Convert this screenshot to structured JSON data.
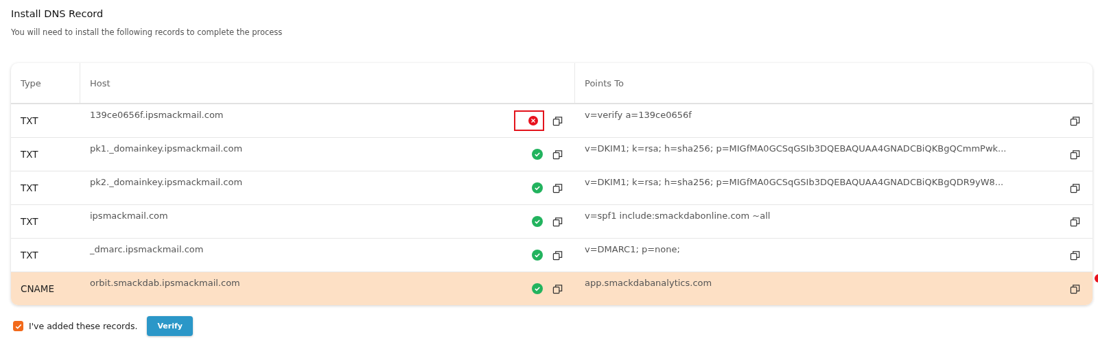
{
  "title": "Install DNS Record",
  "subtitle": "You will need to install the following records to complete the process",
  "table": {
    "columns": [
      "Type",
      "Host",
      "Points To"
    ],
    "rows": [
      {
        "type": "TXT",
        "host": "139ce0656f.ipsmackmail.com",
        "verified": false,
        "flagged": true,
        "points_to": "v=verify a=139ce0656f",
        "selected": false
      },
      {
        "type": "TXT",
        "host": "pk1._domainkey.ipsmackmail.com",
        "verified": true,
        "flagged": false,
        "points_to": "v=DKIM1; k=rsa; h=sha256; p=MIGfMA0GCSqGSIb3DQEBAQUAA4GNADCBiQKBgQCmmPwk...",
        "selected": false
      },
      {
        "type": "TXT",
        "host": "pk2._domainkey.ipsmackmail.com",
        "verified": true,
        "flagged": false,
        "points_to": "v=DKIM1; k=rsa; h=sha256; p=MIGfMA0GCSqGSIb3DQEBAQUAA4GNADCBiQKBgQDR9yW8...",
        "selected": false
      },
      {
        "type": "TXT",
        "host": "ipsmackmail.com",
        "verified": true,
        "flagged": false,
        "points_to": "v=spf1 include:smackdabonline.com ~all",
        "selected": false
      },
      {
        "type": "TXT",
        "host": "_dmarc.ipsmackmail.com",
        "verified": true,
        "flagged": false,
        "points_to": "v=DMARC1; p=none;",
        "selected": false
      },
      {
        "type": "CNAME",
        "host": "orbit.smackdab.ipsmackmail.com",
        "verified": true,
        "flagged": false,
        "points_to": "app.smackdabanalytics.com",
        "selected": true
      }
    ]
  },
  "confirm": {
    "label": "I've added these records.",
    "checked": true
  },
  "verify_button": "Verify"
}
